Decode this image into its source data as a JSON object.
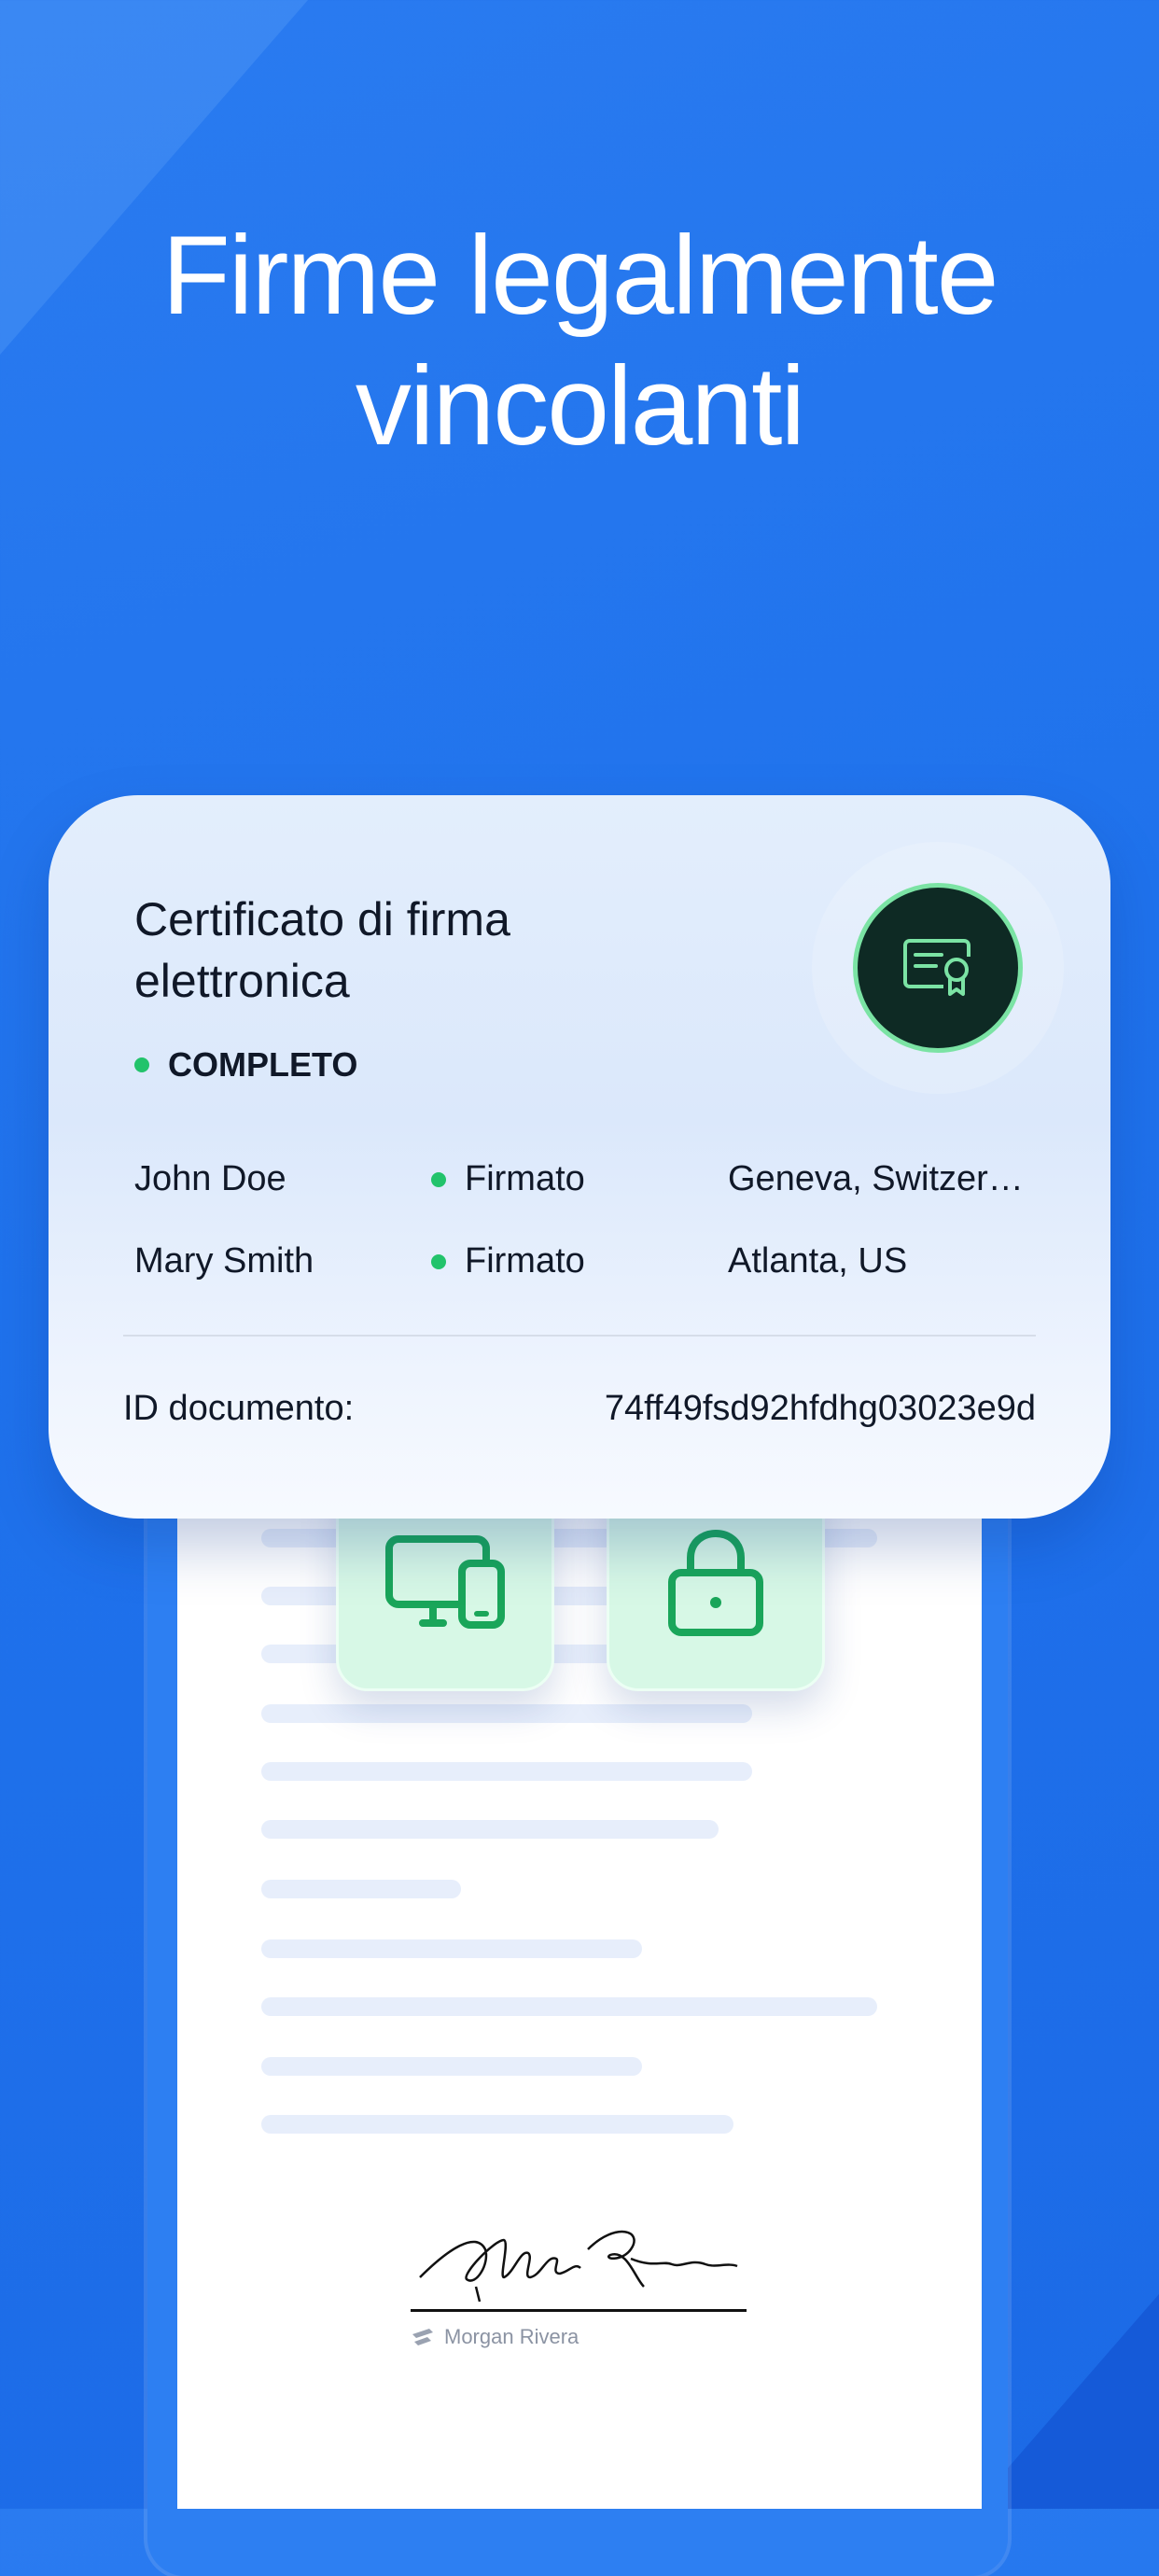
{
  "headline": {
    "line1": "Firme legalmente",
    "line2": "vincolanti"
  },
  "certificate": {
    "title": "Certificato di firma elettronica",
    "badge_icon": "certificate-icon",
    "status_label": "COMPLETO",
    "signers": [
      {
        "name": "John Doe",
        "status": "Firmato",
        "location": "Geneva, Switzer…"
      },
      {
        "name": "Mary Smith",
        "status": "Firmato",
        "location": "Atlanta, US"
      }
    ],
    "document_id_label": "ID documento:",
    "document_id_value": "74ff49fsd92hfdhg03023e9d"
  },
  "tiles": [
    {
      "icon": "devices-icon"
    },
    {
      "icon": "lock-icon"
    }
  ],
  "signature": {
    "script": "Morgan Rivera",
    "signer_name": "Morgan Rivera",
    "logo_icon": "brand-logo-icon"
  },
  "colors": {
    "background": "#1f72ec",
    "accent_green": "#22c36b",
    "badge_dark": "#0e2a24",
    "tile_green": "#d7f8e6"
  }
}
